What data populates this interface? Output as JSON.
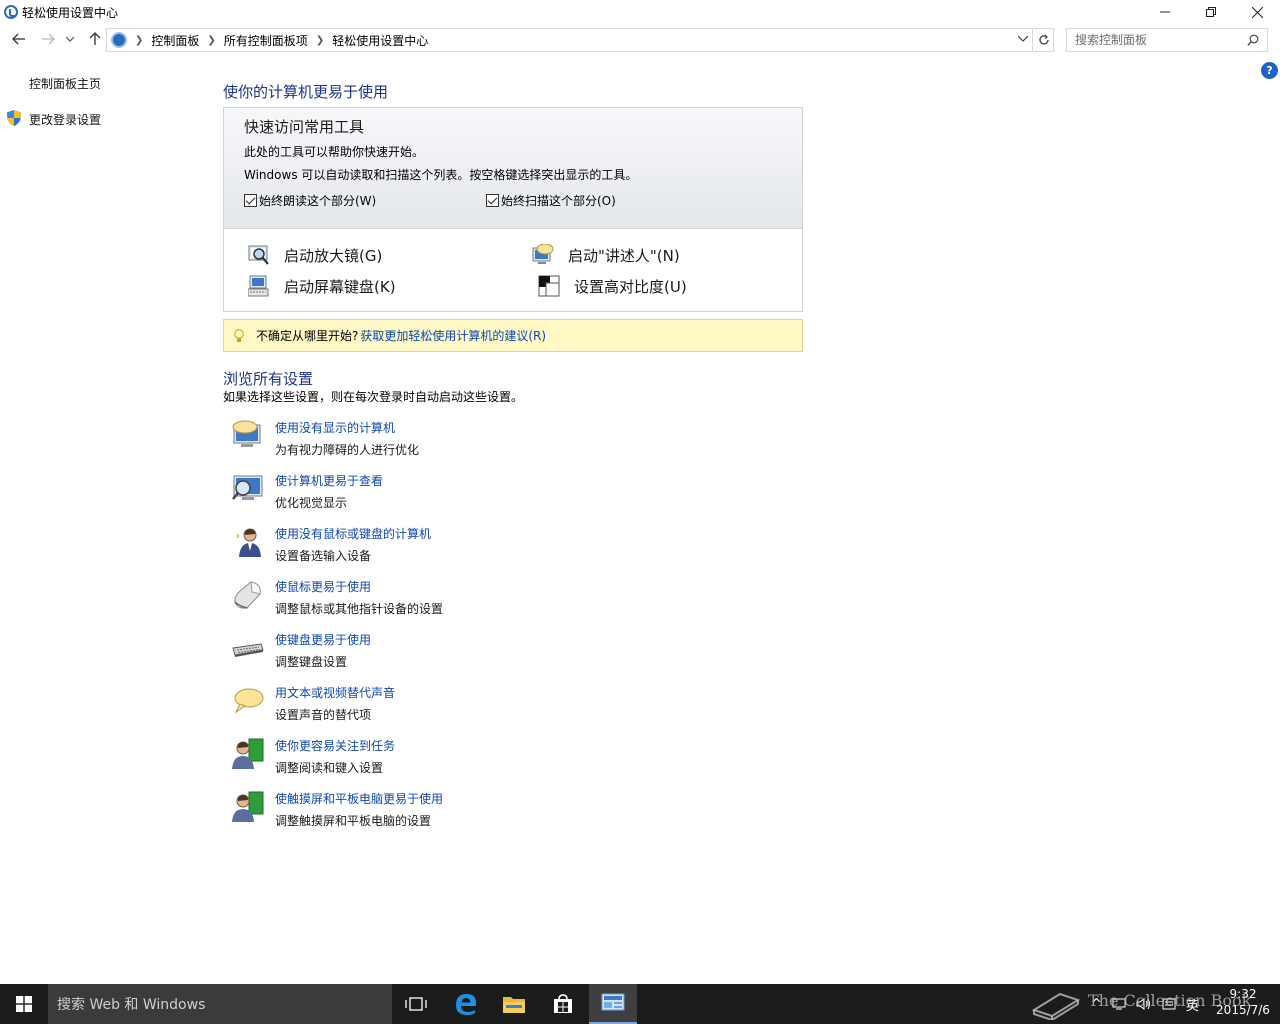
{
  "window": {
    "title": "轻松使用设置中心",
    "minimize_label": "—",
    "restore_label": "❐",
    "close_label": "✕"
  },
  "nav": {
    "back_icon": "arrow-left-icon",
    "forward_icon": "arrow-right-icon",
    "recent_icon": "chevron-down-icon",
    "up_icon": "arrow-up-icon",
    "breadcrumbs": [
      "控制面板",
      "所有控制面板项",
      "轻松使用设置中心"
    ],
    "search_placeholder": "搜索控制面板"
  },
  "sidebar": {
    "home": "控制面板主页",
    "login_settings": "更改登录设置"
  },
  "main": {
    "title": "使你的计算机更易于使用",
    "quick": {
      "heading": "快速访问常用工具",
      "line1": "此处的工具可以帮助你快速开始。",
      "line2": "Windows 可以自动读取和扫描这个列表。按空格键选择突出显示的工具。",
      "read_checkbox": "始终朗读这个部分(W)",
      "read_checked": true,
      "scan_checkbox": "始终扫描这个部分(O)",
      "scan_checked": true,
      "tools": {
        "magnifier": "启动放大镜(G)",
        "narrator": "启动\"讲述人\"(N)",
        "osk": "启动屏幕键盘(K)",
        "high_contrast": "设置高对比度(U)"
      }
    },
    "tip": {
      "text": "不确定从哪里开始?",
      "link": "获取更加轻松使用计算机的建议(R)"
    },
    "browse": {
      "title": "浏览所有设置",
      "desc": "如果选择这些设置，则在每次登录时自动启动这些设置。",
      "items": [
        {
          "link": "使用没有显示的计算机",
          "desc": "为有视力障碍的人进行优化"
        },
        {
          "link": "使计算机更易于查看",
          "desc": "优化视觉显示"
        },
        {
          "link": "使用没有鼠标或键盘的计算机",
          "desc": "设置备选输入设备"
        },
        {
          "link": "使鼠标更易于使用",
          "desc": "调整鼠标或其他指针设备的设置"
        },
        {
          "link": "使键盘更易于使用",
          "desc": "调整键盘设置"
        },
        {
          "link": "用文本或视频替代声音",
          "desc": "设置声音的替代项"
        },
        {
          "link": "使你更容易关注到任务",
          "desc": "调整阅读和键入设置"
        },
        {
          "link": "使触摸屏和平板电脑更易于使用",
          "desc": "调整触摸屏和平板电脑的设置"
        }
      ]
    }
  },
  "taskbar": {
    "search_placeholder": "搜索 Web 和 Windows",
    "tray": {
      "chevron": "^",
      "ime": "英"
    },
    "time": "9:32",
    "date": "2015/7/6",
    "watermark": "The Collection Book"
  }
}
